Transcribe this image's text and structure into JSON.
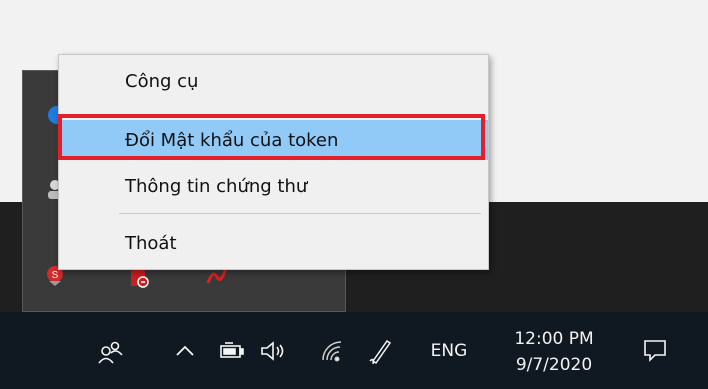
{
  "context_menu": {
    "items": [
      {
        "label": "Công cụ"
      },
      {
        "label": "Đổi Mật khẩu của token",
        "selected": true
      },
      {
        "label": "Thông tin chứng thư"
      },
      {
        "label": "Thoát"
      }
    ]
  },
  "taskbar": {
    "language": "ENG",
    "clock": {
      "time": "12:00 PM",
      "date": "9/7/2020"
    },
    "icons": [
      "people-icon",
      "chevron-up-icon",
      "battery-icon",
      "speaker-icon",
      "wifi-icon",
      "pen-icon",
      "notification-icon"
    ]
  },
  "colors": {
    "highlight": "#91c9f7",
    "annotation_outline": "#e0202a",
    "taskbar": "#101921"
  }
}
